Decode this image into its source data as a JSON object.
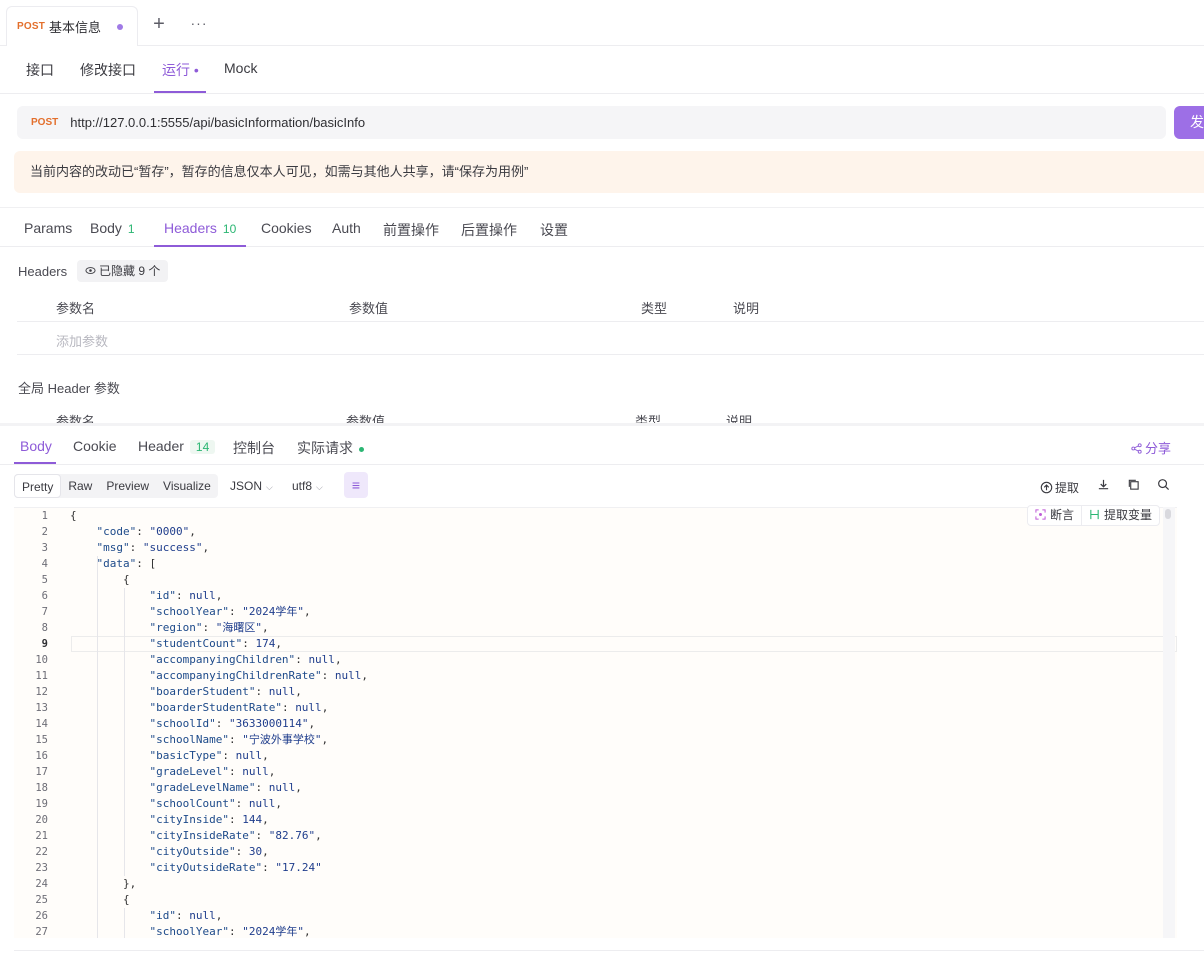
{
  "top_tab": {
    "method": "POST",
    "title": "基本信息",
    "plus": "+",
    "more": "···"
  },
  "sub_tabs": [
    {
      "label": "接口"
    },
    {
      "label": "修改接口"
    },
    {
      "label": "运行 •"
    },
    {
      "label": "Mock"
    }
  ],
  "request": {
    "method": "POST",
    "url": "http://127.0.0.1:5555/api/basicInformation/basicInfo",
    "send_label": "发"
  },
  "notice": "当前内容的改动已“暂存”，暂存的信息仅本人可见，如需与其他人共享，请“保存为用例”",
  "request_tabs": [
    {
      "label": "Params",
      "count": ""
    },
    {
      "label": "Body",
      "count": "1"
    },
    {
      "label": "Headers",
      "count": "10"
    },
    {
      "label": "Cookies",
      "count": ""
    },
    {
      "label": "Auth",
      "count": ""
    },
    {
      "label": "前置操作",
      "count": ""
    },
    {
      "label": "后置操作",
      "count": ""
    },
    {
      "label": "设置",
      "count": ""
    }
  ],
  "headers_section": {
    "label": "Headers",
    "hidden_chip": "已隐藏 9 个",
    "columns": [
      "参数名",
      "参数值",
      "类型",
      "说明"
    ],
    "add_param": "添加参数",
    "global_label": "全局 Header 参数"
  },
  "response_tabs": [
    {
      "label": "Body"
    },
    {
      "label": "Cookie"
    },
    {
      "label": "Header",
      "count": "14"
    },
    {
      "label": "控制台"
    },
    {
      "label": "实际请求"
    }
  ],
  "share_label": "分享",
  "format_tabs": [
    "Pretty",
    "Raw",
    "Preview",
    "Visualize"
  ],
  "format_select": "JSON",
  "encoding_select": "utf8",
  "toolbar": {
    "extract_label": "提取"
  },
  "editor_actions": {
    "assert_label": "断言",
    "extract_var_label": "提取变量"
  },
  "code_lines": [
    {
      "n": "1",
      "t": "{"
    },
    {
      "n": "2",
      "t": "    \"code\": \"0000\","
    },
    {
      "n": "3",
      "t": "    \"msg\": \"success\","
    },
    {
      "n": "4",
      "t": "    \"data\": ["
    },
    {
      "n": "5",
      "t": "        {"
    },
    {
      "n": "6",
      "t": "            \"id\": null,"
    },
    {
      "n": "7",
      "t": "            \"schoolYear\": \"2024学年\","
    },
    {
      "n": "8",
      "t": "            \"region\": \"海曙区\","
    },
    {
      "n": "9",
      "t": "            \"studentCount\": 174,"
    },
    {
      "n": "10",
      "t": "            \"accompanyingChildren\": null,"
    },
    {
      "n": "11",
      "t": "            \"accompanyingChildrenRate\": null,"
    },
    {
      "n": "12",
      "t": "            \"boarderStudent\": null,"
    },
    {
      "n": "13",
      "t": "            \"boarderStudentRate\": null,"
    },
    {
      "n": "14",
      "t": "            \"schoolId\": \"3633000114\","
    },
    {
      "n": "15",
      "t": "            \"schoolName\": \"宁波外事学校\","
    },
    {
      "n": "16",
      "t": "            \"basicType\": null,"
    },
    {
      "n": "17",
      "t": "            \"gradeLevel\": null,"
    },
    {
      "n": "18",
      "t": "            \"gradeLevelName\": null,"
    },
    {
      "n": "19",
      "t": "            \"schoolCount\": null,"
    },
    {
      "n": "20",
      "t": "            \"cityInside\": 144,"
    },
    {
      "n": "21",
      "t": "            \"cityInsideRate\": \"82.76\","
    },
    {
      "n": "22",
      "t": "            \"cityOutside\": 30,"
    },
    {
      "n": "23",
      "t": "            \"cityOutsideRate\": \"17.24\""
    },
    {
      "n": "24",
      "t": "        },"
    },
    {
      "n": "25",
      "t": "        {"
    },
    {
      "n": "26",
      "t": "            \"id\": null,"
    },
    {
      "n": "27",
      "t": "            \"schoolYear\": \"2024学年\","
    }
  ],
  "colors": {
    "accent": "#8e5bd8",
    "method": "#e36f2c",
    "count": "#2bb673"
  }
}
